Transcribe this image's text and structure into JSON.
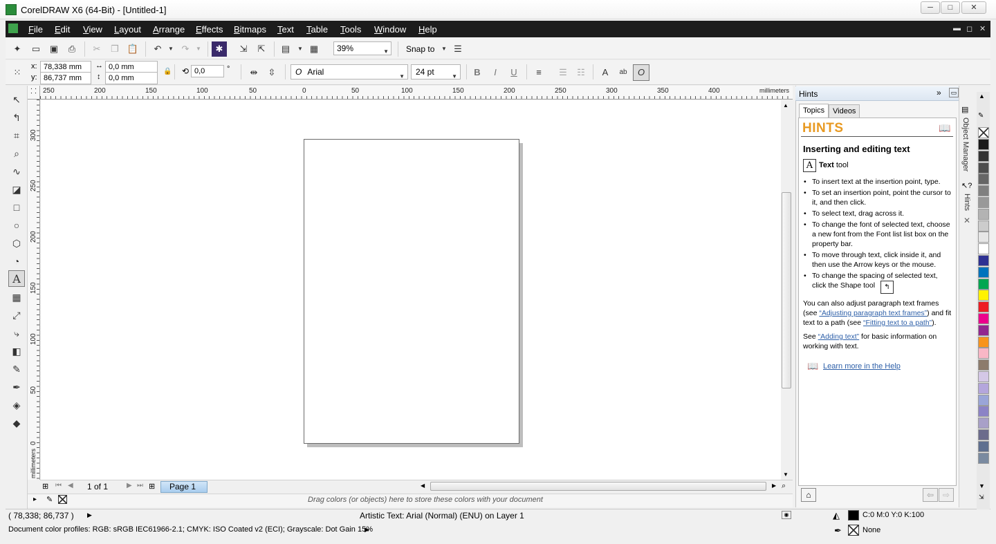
{
  "window": {
    "title": "CorelDRAW X6 (64-Bit) - [Untitled-1]",
    "minimize": "─",
    "maximize": "□",
    "close": "✕"
  },
  "menu": [
    "File",
    "Edit",
    "View",
    "Layout",
    "Arrange",
    "Effects",
    "Bitmaps",
    "Text",
    "Table",
    "Tools",
    "Window",
    "Help"
  ],
  "standard_bar": {
    "zoom": "39%",
    "snap_to": "Snap to"
  },
  "property_bar": {
    "x": "x:",
    "x_value": "78,338 mm",
    "y": "y:",
    "y_value": "86,737 mm",
    "w_value": "0,0 mm",
    "h_value": "0,0 mm",
    "angle": "0,0",
    "degree": "°",
    "font": "Arial",
    "font_size": "24 pt",
    "bold": "B",
    "italic": "I",
    "underline": "U"
  },
  "ruler": {
    "h_ticks": [
      "250",
      "200",
      "150",
      "100",
      "50",
      "0",
      "50",
      "100",
      "150",
      "200",
      "250",
      "300",
      "350",
      "400"
    ],
    "h_unit": "millimeters",
    "v_ticks": [
      "300",
      "250",
      "200",
      "150",
      "100",
      "50",
      "0"
    ],
    "v_unit": "millimeters"
  },
  "page_nav": {
    "count": "1 of 1",
    "tab": "Page 1"
  },
  "doc_palette_hint": "Drag colors (or objects) here to store these colors with your document",
  "status": {
    "coords": "( 78,338; 86,737 )",
    "object_info": "Artistic Text: Arial (Normal) (ENU) on Layer 1",
    "fill": "C:0 M:0 Y:0 K:100",
    "outline": "None",
    "color_profiles": "Document color profiles: RGB: sRGB IEC61966-2.1; CMYK: ISO Coated v2 (ECI); Grayscale: Dot Gain 15%"
  },
  "hints": {
    "panel_title": "Hints",
    "tabs": [
      "Topics",
      "Videos"
    ],
    "header": "HINTS",
    "heading": "Inserting and editing text",
    "tool_name": "Text",
    "tool_suffix": " tool",
    "bullets": [
      "To insert text at the insertion point, type.",
      "To set an insertion point, point the cursor to it, and then click.",
      "To select text, drag across it.",
      "To change the font of selected text, choose a new font from the Font list list box on the property bar.",
      "To move through text, click inside it, and then use the Arrow keys or the mouse.",
      "To change the spacing of selected text, click the Shape tool"
    ],
    "para1_a": "You can also adjust paragraph text frames (see ",
    "para1_link1": "“Adjusting paragraph text frames”",
    "para1_b": ") and fit text to a path (see ",
    "para1_link2": "“Fitting text to a path”",
    "para1_c": ").",
    "para2_a": "See ",
    "para2_link": "“Adding text”",
    "para2_b": " for basic information on working with text.",
    "learn_more": "Learn more in the Help"
  },
  "dock_labels": {
    "object_manager": "Object Manager",
    "hints": "Hints"
  },
  "palette_colors": [
    "#1a1a1a",
    "#333333",
    "#4d4d4d",
    "#666666",
    "#808080",
    "#999999",
    "#b3b3b3",
    "#cccccc",
    "#e6e6e6",
    "#ffffff",
    "#2e3192",
    "#0072bc",
    "#00a651",
    "#fff200",
    "#ed1c24",
    "#ec008c",
    "#92278f",
    "#f7941d",
    "#f9b7c6",
    "#8c7b6c",
    "#d4c8e6",
    "#b4a6dc",
    "#9aa5d8",
    "#8c83c6",
    "#a8a0c8",
    "#6c6c8c",
    "#5e6f8f",
    "#7a8aa0"
  ],
  "icons": {
    "app": "coreldraw-logo-icon"
  }
}
